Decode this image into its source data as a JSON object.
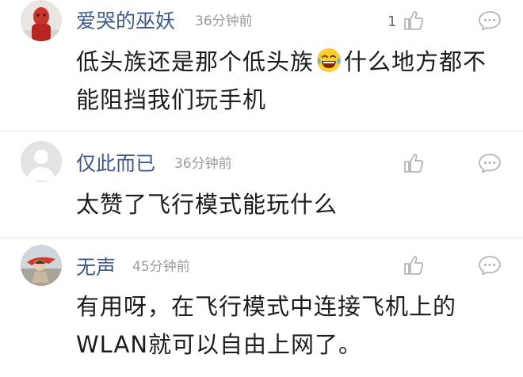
{
  "comments": [
    {
      "username": "爱哭的巫妖",
      "time": "36分钟前",
      "likes": "1",
      "text_before_emoji": "低头族还是那个低头族",
      "emoji": "laughing-tears-emoji",
      "text_after_emoji": "什么地方都不能阻挡我们玩手机"
    },
    {
      "username": "仅此而已",
      "time": "36分钟前",
      "likes": "",
      "text": "太赞了飞行模式能玩什么"
    },
    {
      "username": "无声",
      "time": "45分钟前",
      "likes": "",
      "text": "有用呀，在飞行模式中连接飞机上的WLAN就可以自由上网了。"
    }
  ],
  "icons": {
    "like": "thumbs-up-icon",
    "reply": "comment-bubble-icon"
  },
  "colors": {
    "username": "#3d5a8a",
    "timestamp": "#9a9a9a",
    "body_text": "#1c1c1c",
    "icon": "#b5b5b5"
  }
}
